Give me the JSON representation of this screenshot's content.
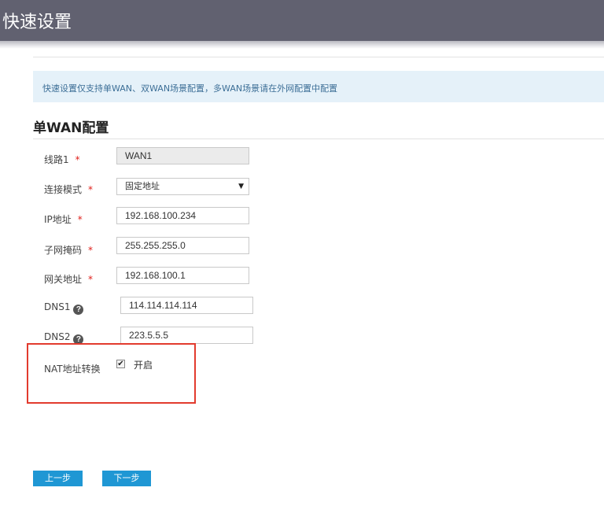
{
  "header": {
    "title": "快速设置"
  },
  "notice": {
    "text": "快速设置仅支持单WAN、双WAN场景配置，多WAN场景请在外网配置中配置"
  },
  "section": {
    "title": "单WAN配置"
  },
  "form": {
    "line": {
      "label": "线路1",
      "required_mark": "*",
      "value": "WAN1"
    },
    "mode": {
      "label": "连接模式",
      "required_mark": "*",
      "value": "固定地址",
      "arrow": "▼"
    },
    "ip": {
      "label": "IP地址",
      "required_mark": "*",
      "value": "192.168.100.234"
    },
    "mask": {
      "label": "子网掩码",
      "required_mark": "*",
      "value": "255.255.255.0"
    },
    "gateway": {
      "label": "网关地址",
      "required_mark": "*",
      "value": "192.168.100.1"
    },
    "dns1": {
      "label": "DNS1",
      "help_glyph": "?",
      "value": "114.114.114.114"
    },
    "dns2": {
      "label": "DNS2",
      "help_glyph": "?",
      "value": "223.5.5.5"
    },
    "nat": {
      "label": "NAT地址转换",
      "check_glyph": "✔",
      "checked": true,
      "option_label": "开启"
    }
  },
  "buttons": {
    "prev": "上一步",
    "next": "下一步"
  },
  "colors": {
    "header_bg": "#616170",
    "notice_bg": "#e5f1f9",
    "required": "#e0201b",
    "button": "#1f97d4",
    "highlight": "#e23b2e"
  },
  "icons": [
    "help-icon",
    "chevron-down-icon",
    "checkbox-checked-icon"
  ]
}
